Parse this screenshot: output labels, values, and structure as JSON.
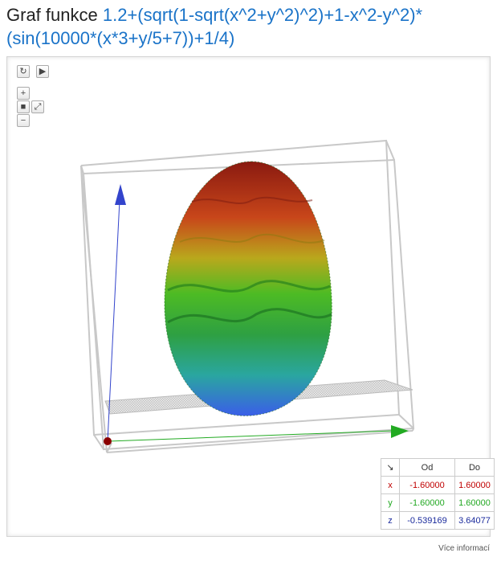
{
  "title": {
    "prefix": "Graf funkce",
    "function_line1": "1.2+(sqrt(1-sqrt(x^2+y^2)^2)+1-x^2-y^2)*",
    "function_line2": "(sin(10000*(x*3+y/5+7))+1/4)"
  },
  "controls": {
    "reset": "↻",
    "play": "▶",
    "zoom_in": "+",
    "zoom_out": "−",
    "camera": "■",
    "axes": "⤢"
  },
  "range_table": {
    "corner": "↘",
    "headers": [
      "Od",
      "Do"
    ],
    "rows": [
      {
        "axis": "x",
        "from": "-1.60000",
        "to": "1.60000",
        "color": "#c00000"
      },
      {
        "axis": "y",
        "from": "-1.60000",
        "to": "1.60000",
        "color": "#22a822"
      },
      {
        "axis": "z",
        "from": "-0.539169",
        "to": "3.64077",
        "color": "#1a2a9c"
      }
    ]
  },
  "more_info": "Více informací",
  "colors": {
    "function": "#1a73c8",
    "x_axis": "#8b0000",
    "y_axis": "#22aa22",
    "z_axis": "#3344cc"
  }
}
